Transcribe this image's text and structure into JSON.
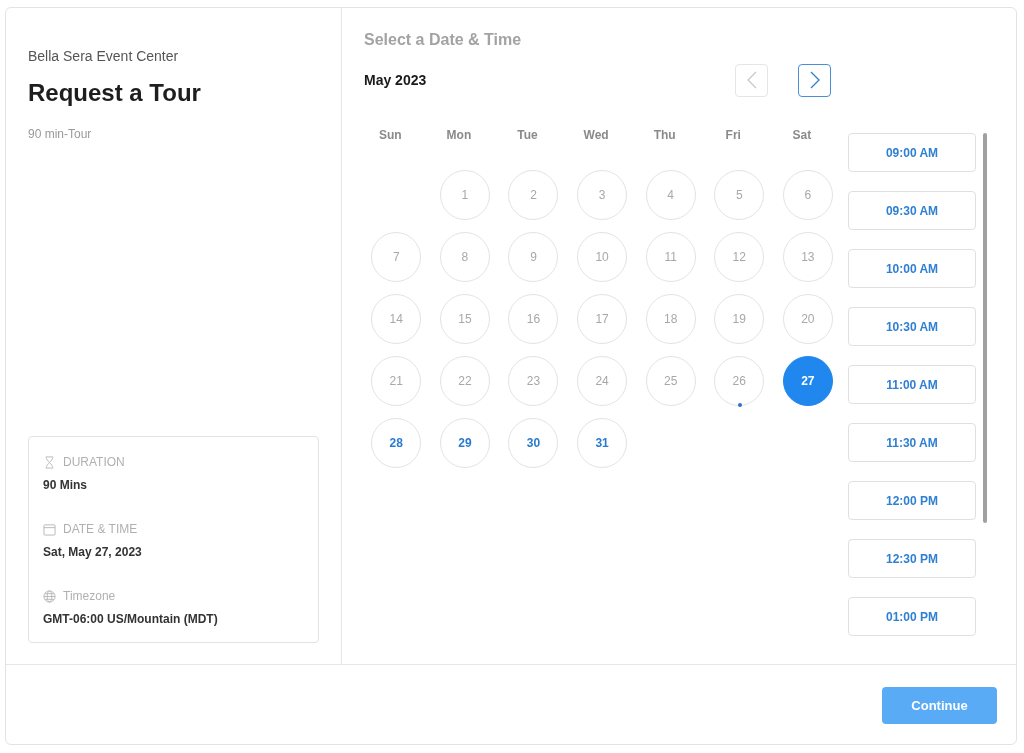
{
  "venue": "Bella Sera Event Center",
  "title": "Request a Tour",
  "subtitle": "90 min-Tour",
  "summary": [
    {
      "kind": "duration",
      "label": "DURATION",
      "value": "90 Mins"
    },
    {
      "kind": "date",
      "label": "DATE & TIME",
      "value": "Sat, May 27, 2023"
    },
    {
      "kind": "timezone",
      "label": "Timezone",
      "value": "GMT-06:00 US/Mountain (MDT)"
    }
  ],
  "heading": "Select a Date & Time",
  "month": "May 2023",
  "nav": [
    {
      "kind": "prev",
      "disabled": true
    },
    {
      "kind": "next",
      "disabled": false
    }
  ],
  "weekdays": [
    "Sun",
    "Mon",
    "Tue",
    "Wed",
    "Thu",
    "Fri",
    "Sat"
  ],
  "days": [
    {
      "kind": "blank"
    },
    {
      "kind": "day",
      "label": "1",
      "disabled": true,
      "selected": false,
      "today": false
    },
    {
      "kind": "day",
      "label": "2",
      "disabled": true,
      "selected": false,
      "today": false
    },
    {
      "kind": "day",
      "label": "3",
      "disabled": true,
      "selected": false,
      "today": false
    },
    {
      "kind": "day",
      "label": "4",
      "disabled": true,
      "selected": false,
      "today": false
    },
    {
      "kind": "day",
      "label": "5",
      "disabled": true,
      "selected": false,
      "today": false
    },
    {
      "kind": "day",
      "label": "6",
      "disabled": true,
      "selected": false,
      "today": false
    },
    {
      "kind": "day",
      "label": "7",
      "disabled": true,
      "selected": false,
      "today": false
    },
    {
      "kind": "day",
      "label": "8",
      "disabled": true,
      "selected": false,
      "today": false
    },
    {
      "kind": "day",
      "label": "9",
      "disabled": true,
      "selected": false,
      "today": false
    },
    {
      "kind": "day",
      "label": "10",
      "disabled": true,
      "selected": false,
      "today": false
    },
    {
      "kind": "day",
      "label": "11",
      "disabled": true,
      "selected": false,
      "today": false
    },
    {
      "kind": "day",
      "label": "12",
      "disabled": true,
      "selected": false,
      "today": false
    },
    {
      "kind": "day",
      "label": "13",
      "disabled": true,
      "selected": false,
      "today": false
    },
    {
      "kind": "day",
      "label": "14",
      "disabled": true,
      "selected": false,
      "today": false
    },
    {
      "kind": "day",
      "label": "15",
      "disabled": true,
      "selected": false,
      "today": false
    },
    {
      "kind": "day",
      "label": "16",
      "disabled": true,
      "selected": false,
      "today": false
    },
    {
      "kind": "day",
      "label": "17",
      "disabled": true,
      "selected": false,
      "today": false
    },
    {
      "kind": "day",
      "label": "18",
      "disabled": true,
      "selected": false,
      "today": false
    },
    {
      "kind": "day",
      "label": "19",
      "disabled": true,
      "selected": false,
      "today": false
    },
    {
      "kind": "day",
      "label": "20",
      "disabled": true,
      "selected": false,
      "today": false
    },
    {
      "kind": "day",
      "label": "21",
      "disabled": true,
      "selected": false,
      "today": false
    },
    {
      "kind": "day",
      "label": "22",
      "disabled": true,
      "selected": false,
      "today": false
    },
    {
      "kind": "day",
      "label": "23",
      "disabled": true,
      "selected": false,
      "today": false
    },
    {
      "kind": "day",
      "label": "24",
      "disabled": true,
      "selected": false,
      "today": false
    },
    {
      "kind": "day",
      "label": "25",
      "disabled": true,
      "selected": false,
      "today": false
    },
    {
      "kind": "day",
      "label": "26",
      "disabled": true,
      "selected": false,
      "today": true
    },
    {
      "kind": "day",
      "label": "27",
      "disabled": false,
      "selected": true,
      "today": false
    },
    {
      "kind": "day",
      "label": "28",
      "disabled": false,
      "selected": false,
      "today": false
    },
    {
      "kind": "day",
      "label": "29",
      "disabled": false,
      "selected": false,
      "today": false
    },
    {
      "kind": "day",
      "label": "30",
      "disabled": false,
      "selected": false,
      "today": false
    },
    {
      "kind": "day",
      "label": "31",
      "disabled": false,
      "selected": false,
      "today": false
    }
  ],
  "times": [
    "09:00 AM",
    "09:30 AM",
    "10:00 AM",
    "10:30 AM",
    "11:00 AM",
    "11:30 AM",
    "12:00 PM",
    "12:30 PM",
    "01:00 PM"
  ],
  "continue": {
    "label": "Continue"
  }
}
